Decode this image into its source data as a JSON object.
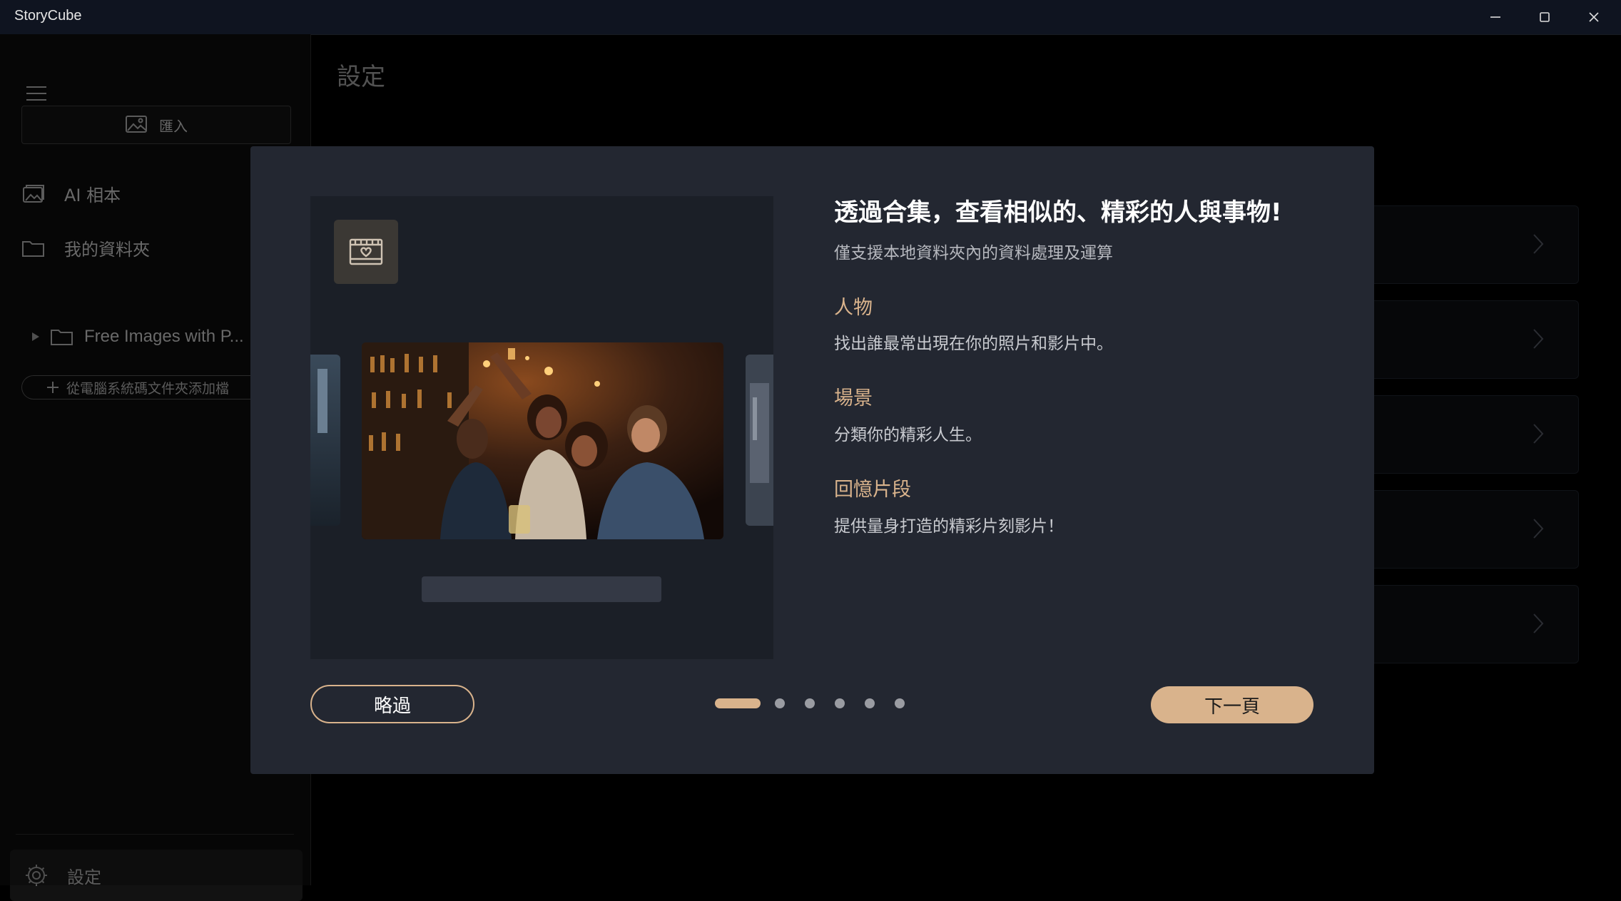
{
  "window": {
    "title": "StoryCube",
    "controls": [
      "minimize",
      "maximize",
      "close"
    ]
  },
  "sidebar": {
    "import_label": "匯入",
    "items": [
      {
        "label": "AI 相本",
        "icon": "ai-album-icon"
      },
      {
        "label": "我的資料夾",
        "icon": "folder-icon"
      }
    ],
    "tree_item": "Free Images with P...",
    "add_folder_label": "從電腦系統碼文件夾添加檔",
    "settings_label": "設定"
  },
  "main": {
    "title": "設定"
  },
  "modal": {
    "title": "透過合集，查看相似的、精彩的人與事物!",
    "subtitle": "僅支援本地資料夾內的資料處理及運算",
    "features": [
      {
        "title": "人物",
        "desc": "找出誰最常出現在你的照片和影片中。"
      },
      {
        "title": "場景",
        "desc": "分類你的精彩人生。"
      },
      {
        "title": "回憶片段",
        "desc": "提供量身打造的精彩片刻影片！"
      }
    ],
    "skip_label": "略過",
    "next_label": "下一頁",
    "page_total": 6,
    "page_current": 1
  },
  "colors": {
    "accent": "#d9b38c",
    "modal_bg": "#232731",
    "titlebar_bg": "#0f1420"
  }
}
